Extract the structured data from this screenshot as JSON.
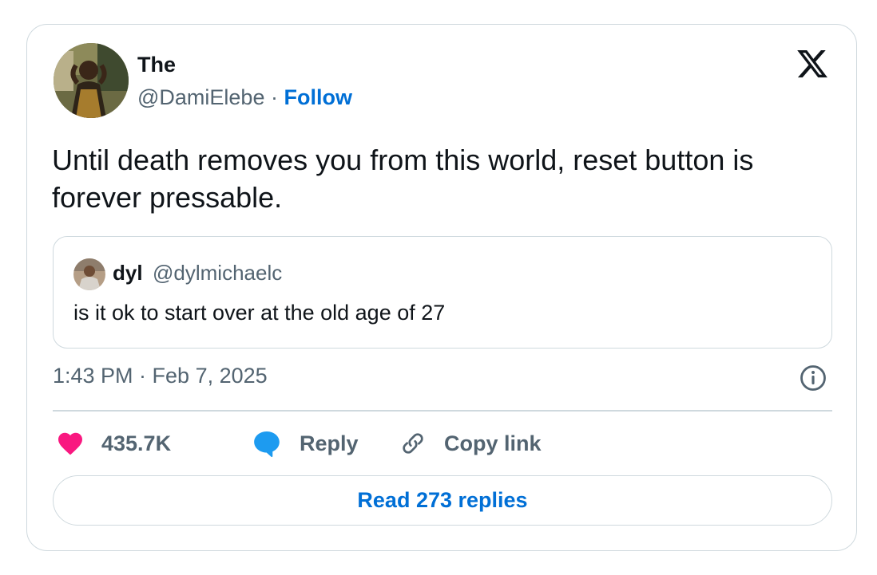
{
  "author": {
    "name": "The",
    "handle": "@DamiElebe",
    "separator": " · ",
    "follow_label": "Follow"
  },
  "tweet": {
    "text": "Until death removes you from this world, reset button is forever pressable.",
    "timestamp": "1:43 PM · Feb 7, 2025"
  },
  "quoted": {
    "name": "dyl",
    "handle": "@dylmichaelc",
    "text": "is it ok to start over at the old age of 27"
  },
  "actions": {
    "likes": "435.7K",
    "reply_label": "Reply",
    "copy_link_label": "Copy link"
  },
  "read_replies_label": "Read 273 replies",
  "colors": {
    "like": "#f91880",
    "reply": "#1d9bf0",
    "link": "#006fd6",
    "muted": "#536471",
    "border": "#cfd9de"
  },
  "icons": [
    "x-logo-icon",
    "info-icon",
    "heart-icon",
    "reply-bubble-icon",
    "link-icon"
  ]
}
